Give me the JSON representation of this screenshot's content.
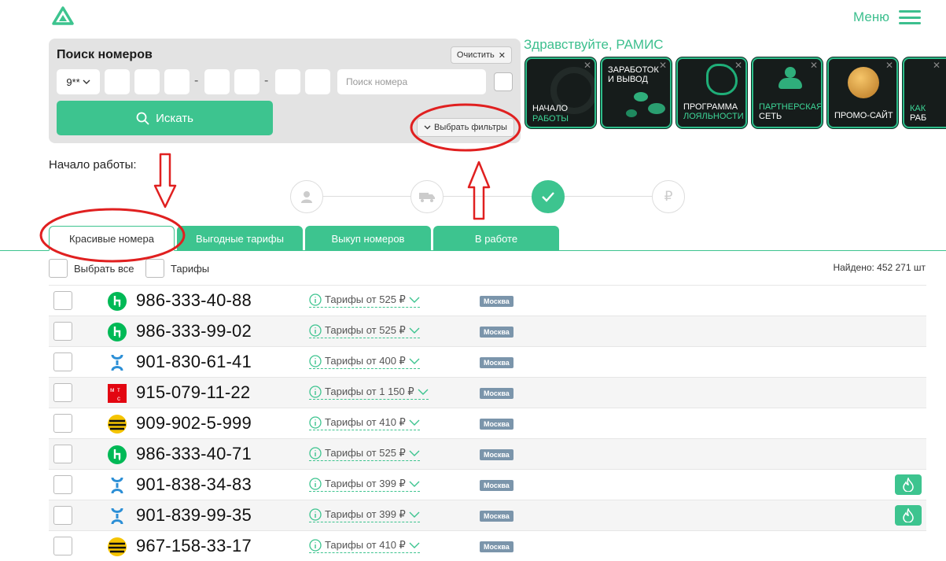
{
  "header": {
    "menu_label": "Меню",
    "logo_icon": "triangle-logo-icon",
    "menu_icon": "hamburger-icon"
  },
  "search": {
    "title": "Поиск номеров",
    "clear_label": "Очистить",
    "prefix_value": "9**",
    "number_placeholder": "Поиск номера",
    "search_button_label": "Искать",
    "filters_label": "Выбрать фильтры"
  },
  "greeting": "Здравствуйте, РАМИС",
  "stories": [
    {
      "line1": "НАЧАЛО",
      "line2": "РАБОТЫ"
    },
    {
      "line1": "ЗАРАБОТОК",
      "line2": "И ВЫВОД"
    },
    {
      "line1": "ПРОГРАММА",
      "line2": "ЛОЯЛЬНОСТИ"
    },
    {
      "line1": "ПАРТНЕРСКАЯ",
      "line2": "СЕТЬ"
    },
    {
      "line1": "ПРОМО-САЙТ",
      "line2": ""
    },
    {
      "line1": "КАК",
      "line2": "РАБ"
    }
  ],
  "steps": {
    "label": "Начало работы:"
  },
  "tabs": [
    {
      "label": "Красивые номера"
    },
    {
      "label": "Выгодные тарифы"
    },
    {
      "label": "Выкуп номеров"
    },
    {
      "label": "В работе"
    }
  ],
  "list": {
    "select_all_label": "Выбрать все",
    "tariffs_label": "Тарифы",
    "found_label": "Найдено: 452 271 шт",
    "rows": [
      {
        "number": "986-333-40-88",
        "operator": "megafon",
        "tariff": "Тарифы от 525 ₽",
        "region": "Москва",
        "hot": false
      },
      {
        "number": "986-333-99-02",
        "operator": "megafon",
        "tariff": "Тарифы от 525 ₽",
        "region": "Москва",
        "hot": false
      },
      {
        "number": "901-830-61-41",
        "operator": "tele2",
        "tariff": "Тарифы от 400 ₽",
        "region": "Москва",
        "hot": false
      },
      {
        "number": "915-079-11-22",
        "operator": "mts",
        "tariff": "Тарифы от 1 150 ₽",
        "region": "Москва",
        "hot": false
      },
      {
        "number": "909-902-5-999",
        "operator": "beeline",
        "tariff": "Тарифы от 410 ₽",
        "region": "Москва",
        "hot": false
      },
      {
        "number": "986-333-40-71",
        "operator": "megafon",
        "tariff": "Тарифы от 525 ₽",
        "region": "Москва",
        "hot": false
      },
      {
        "number": "901-838-34-83",
        "operator": "tele2",
        "tariff": "Тарифы от 399 ₽",
        "region": "Москва",
        "hot": true
      },
      {
        "number": "901-839-99-35",
        "operator": "tele2",
        "tariff": "Тарифы от 399 ₽",
        "region": "Москва",
        "hot": true
      },
      {
        "number": "967-158-33-17",
        "operator": "beeline",
        "tariff": "Тарифы от 410 ₽",
        "region": "Москва",
        "hot": false
      }
    ]
  },
  "colors": {
    "accent": "#3dc48f",
    "annotation": "#e02020",
    "region_badge": "#7b95ab"
  }
}
